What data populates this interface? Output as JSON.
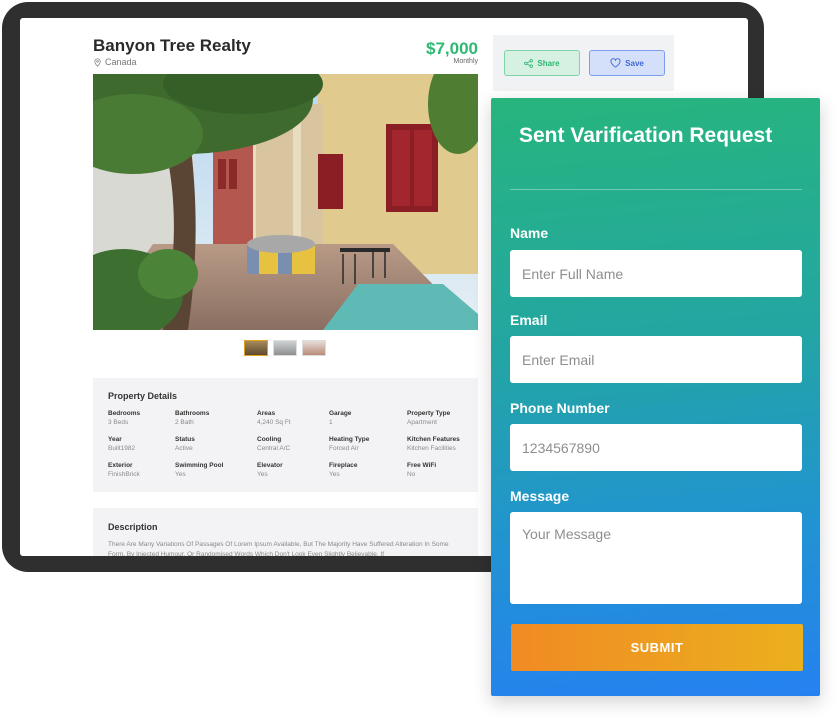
{
  "listing": {
    "title": "Banyon Tree Realty",
    "location": "Canada",
    "price": "$7,000",
    "price_period": "Monthly"
  },
  "actions": {
    "share_label": "Share",
    "save_label": "Save"
  },
  "property_details": {
    "title": "Property Details",
    "items": [
      {
        "label": "Bedrooms",
        "value": "3 Beds"
      },
      {
        "label": "Bathrooms",
        "value": "2 Bath"
      },
      {
        "label": "Areas",
        "value": "4,240 Sq Ft"
      },
      {
        "label": "Garage",
        "value": "1"
      },
      {
        "label": "Property Type",
        "value": "Apartment"
      },
      {
        "label": "Year",
        "value": "Built1982"
      },
      {
        "label": "Status",
        "value": "Active"
      },
      {
        "label": "Cooling",
        "value": "Central A/C"
      },
      {
        "label": "Heating Type",
        "value": "Forced Air"
      },
      {
        "label": "Kitchen Features",
        "value": "Kitchen Facilities"
      },
      {
        "label": "Exterior",
        "value": "FinishBrick"
      },
      {
        "label": "Swimming Pool",
        "value": "Yes"
      },
      {
        "label": "Elevator",
        "value": "Yes"
      },
      {
        "label": "Fireplace",
        "value": "Yes"
      },
      {
        "label": "Free WiFi",
        "value": "No"
      }
    ]
  },
  "description": {
    "title": "Description",
    "text": "There Are Many Variations Of Passages Of Lorem Ipsum Available, But The Majority Have Suffered Alteration In Some Form, By Injected Humour, Or Randomised Words Which Don't Look Even Slightly Believable. If"
  },
  "form": {
    "title": "Sent Varification Request",
    "name_label": "Name",
    "name_placeholder": "Enter Full Name",
    "email_label": "Email",
    "email_placeholder": "Enter Email",
    "phone_label": "Phone Number",
    "phone_placeholder": "1234567890",
    "message_label": "Message",
    "message_placeholder": "Your Message",
    "submit_label": "SUBMIT"
  },
  "colors": {
    "price": "#2eb872",
    "share_accent": "#2eb872",
    "save_accent": "#3f67d8",
    "form_gradient_top": "#27b57d",
    "form_gradient_bottom": "#2581f0",
    "submit_gradient_start": "#f08a24",
    "submit_gradient_end": "#ebb01e"
  },
  "icons": {
    "location": "map-pin-icon",
    "share": "share-icon",
    "save": "heart-icon"
  }
}
